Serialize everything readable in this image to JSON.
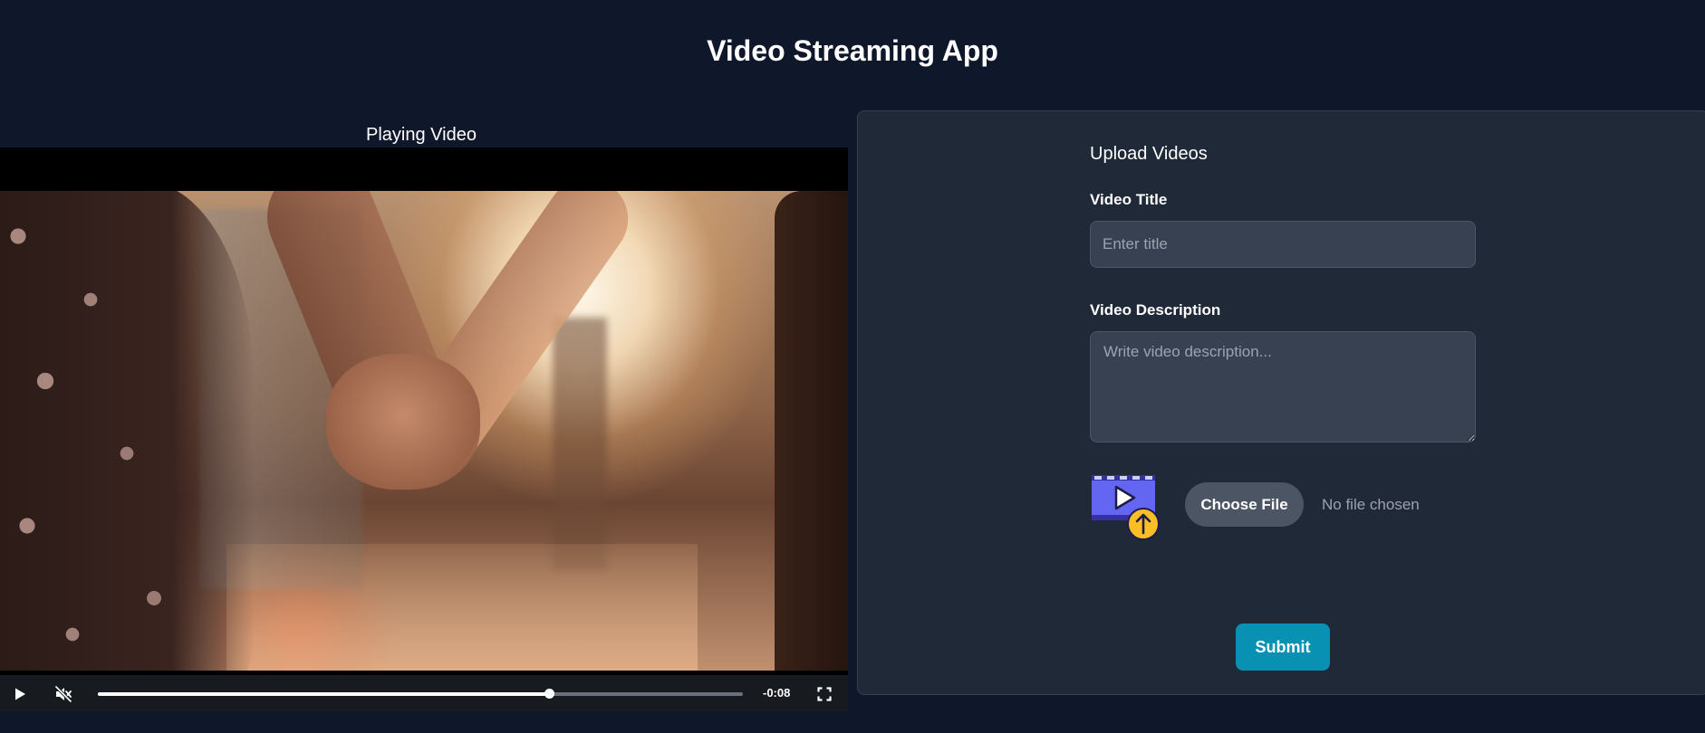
{
  "app": {
    "title": "Video Streaming App"
  },
  "player": {
    "heading": "Playing Video",
    "time_remaining": "-0:08",
    "progress_fraction": 0.7,
    "muted": true,
    "playing": false,
    "icons": {
      "play": "play-icon",
      "mute": "volume-muted-icon",
      "fullscreen": "fullscreen-icon"
    }
  },
  "upload": {
    "heading": "Upload Videos",
    "title_label": "Video Title",
    "title_placeholder": "Enter title",
    "title_value": "",
    "description_label": "Video Description",
    "description_placeholder": "Write video description...",
    "description_value": "",
    "choose_file_label": "Choose File",
    "file_status": "No file chosen",
    "submit_label": "Submit",
    "illustration_icon": "video-upload-icon"
  },
  "colors": {
    "background": "#0f172a",
    "panel": "#1f2937",
    "input": "#374151",
    "accent": "#0891b2",
    "illustration_purple": "#6366f1",
    "illustration_yellow": "#fbbf24"
  }
}
